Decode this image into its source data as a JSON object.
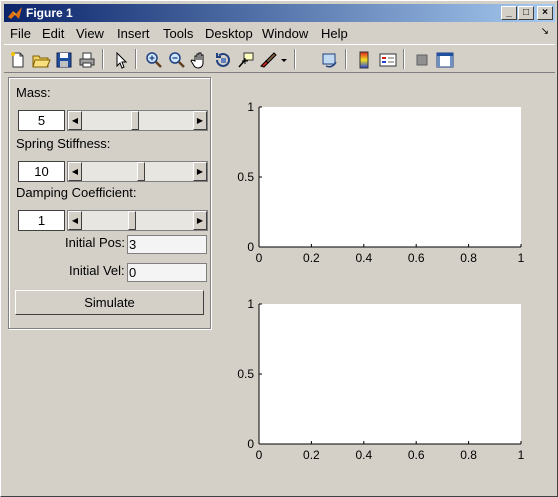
{
  "window": {
    "title": "Figure 1",
    "controls": {
      "minimize": "_",
      "maximize": "□",
      "close": "×"
    }
  },
  "menubar": {
    "items": [
      "File",
      "Edit",
      "View",
      "Insert",
      "Tools",
      "Desktop",
      "Window",
      "Help"
    ],
    "overflow_icon": "dock-arrow-icon"
  },
  "toolbar": {
    "buttons": [
      "new-figure-icon",
      "open-file-icon",
      "save-icon",
      "print-icon",
      "edit-plot-arrow-icon",
      "zoom-in-icon",
      "zoom-out-icon",
      "pan-hand-icon",
      "rotate-3d-icon",
      "data-cursor-icon",
      "brush-icon",
      "link-plot-icon",
      "colorbar-icon",
      "legend-icon",
      "hide-plot-tools-icon",
      "show-plot-tools-icon"
    ]
  },
  "panel": {
    "mass": {
      "label": "Mass:",
      "value": "5",
      "slider_level": 0.48
    },
    "stiffness": {
      "label": "Spring Stiffness:",
      "value": "10",
      "slider_level": 0.53
    },
    "damping": {
      "label": "Damping Coefficient:",
      "value": "1",
      "slider_level": 0.45
    },
    "initial_pos": {
      "label": "Initial Pos:",
      "value": "3"
    },
    "initial_vel": {
      "label": "Initial Vel:",
      "value": "0"
    },
    "simulate_label": "Simulate"
  },
  "chart_data": [
    {
      "type": "line",
      "series": [],
      "xlim": [
        0,
        1
      ],
      "ylim": [
        0,
        1
      ],
      "x_ticks": [
        "0",
        "0.2",
        "0.4",
        "0.6",
        "0.8",
        "1"
      ],
      "y_ticks": [
        "0",
        "0.5",
        "1"
      ],
      "grid": false
    },
    {
      "type": "line",
      "series": [],
      "xlim": [
        0,
        1
      ],
      "ylim": [
        0,
        1
      ],
      "x_ticks": [
        "0",
        "0.2",
        "0.4",
        "0.6",
        "0.8",
        "1"
      ],
      "y_ticks": [
        "0",
        "0.5",
        "1"
      ],
      "grid": false
    }
  ]
}
